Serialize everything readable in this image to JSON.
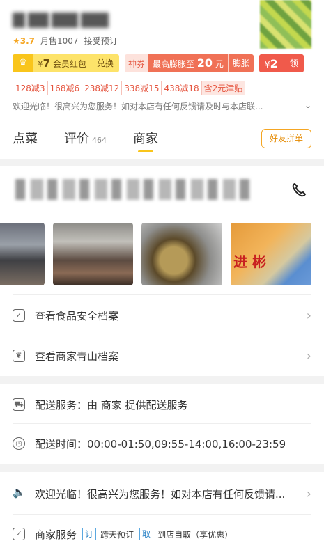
{
  "shop": {
    "rating": "3.7",
    "monthly_sales": "月售1007",
    "reservation": "接受预订"
  },
  "coupons": {
    "vip_amount": "7",
    "vip_label": "会员红包",
    "vip_action": "兑换",
    "shenquan_tag": "神券",
    "shenquan_text": "最高膨胀至",
    "shenquan_amount": "20",
    "shenquan_unit": "元",
    "shenquan_action": "膨胀",
    "red_amount": "2",
    "red_action": "领"
  },
  "discounts": [
    "128减3",
    "168减6",
    "238减12",
    "338减15",
    "438减18",
    "含2元津贴"
  ],
  "notice_short": "欢迎光临！很高兴为您服务！如对本店有任何反馈请及时与本店联...",
  "tabs": {
    "order": "点菜",
    "reviews": "评价",
    "reviews_count": "464",
    "merchant": "商家"
  },
  "group_button": "好友拼单",
  "rows": {
    "food_safety": "查看食品安全档案",
    "qingshan": "查看商家青山档案",
    "delivery_service": "配送服务：由 商家 提供配送服务",
    "delivery_time": "配送时间：00:00-01:50,09:55-14:00,16:00-23:59",
    "notice_full": "欢迎光临！很高兴为您服务！如对本店有任何反馈请...",
    "merchant_service": "商家服务",
    "svc_tag1": "订",
    "svc_text1": "跨天预订",
    "svc_tag2": "取",
    "svc_text2": "到店自取（享优惠）"
  },
  "photo_sign": "进 彬",
  "icons": {
    "phone": "phone-icon",
    "safety": "shield-icon",
    "leaf": "leaf-icon",
    "delivery": "scooter-icon",
    "clock": "clock-icon",
    "speaker": "speaker-icon",
    "check": "check-box-icon"
  },
  "colors": {
    "accent": "#f9c51b",
    "coupon_red": "#f05a4b",
    "discount_red": "#e5533d"
  }
}
